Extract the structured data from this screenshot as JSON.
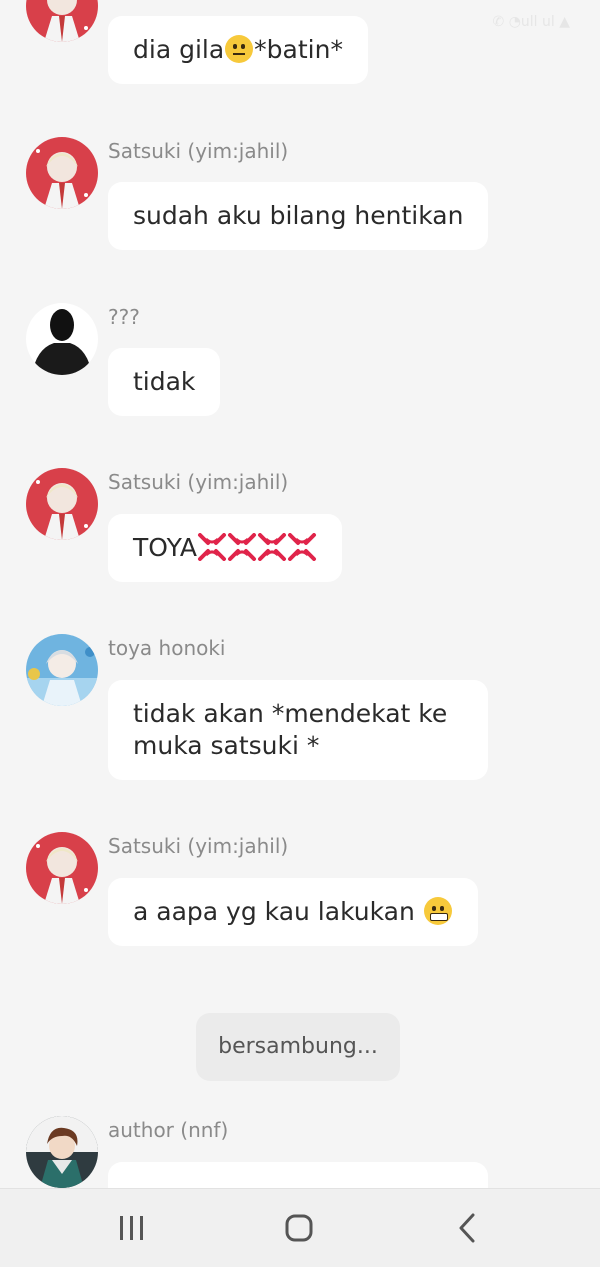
{
  "status_bar": {
    "text": "✆ ◔ull ul ▲"
  },
  "messages": [
    {
      "sender": "",
      "avatar": "satsuki-avatar",
      "text_before": "dia gila",
      "emoji": "neutral-face",
      "text_after": "*batin*"
    },
    {
      "sender": "Satsuki (yim:jahil)",
      "avatar": "satsuki-avatar",
      "text": "sudah aku bilang hentikan"
    },
    {
      "sender": "???",
      "avatar": "silhouette-avatar",
      "text": "tidak"
    },
    {
      "sender": "Satsuki (yim:jahil)",
      "avatar": "satsuki-avatar",
      "text": "TOYA",
      "emoji": "anger-symbol",
      "emoji_count": 4
    },
    {
      "sender": "toya honoki",
      "avatar": "toya-avatar",
      "text": "tidak akan *mendekat ke muka satsuki *"
    },
    {
      "sender": "Satsuki (yim:jahil)",
      "avatar": "satsuki-avatar",
      "text": "a aapa yg kau lakukan ",
      "emoji": "grimacing-face"
    },
    {
      "sender": "author (nnf)",
      "avatar": "author-avatar",
      "text": ""
    }
  ],
  "system_message": "bersambung...",
  "navbar": {
    "recents": "recents-icon",
    "home": "home-icon",
    "back": "back-icon"
  }
}
